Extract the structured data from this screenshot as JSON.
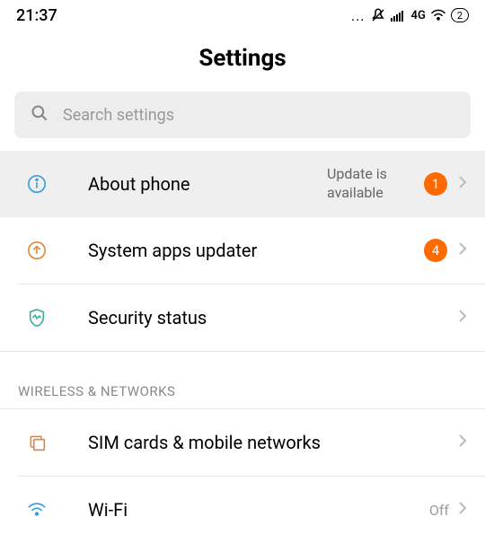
{
  "statusbar": {
    "time": "21:37",
    "network": "4G",
    "battery": "2"
  },
  "page": {
    "title": "Settings"
  },
  "search": {
    "placeholder": "Search settings"
  },
  "items": {
    "about": {
      "label": "About phone",
      "subtext": "Update is available",
      "badge": "1"
    },
    "updater": {
      "label": "System apps updater",
      "badge": "4"
    },
    "security": {
      "label": "Security status"
    }
  },
  "section": {
    "wireless": "WIRELESS & NETWORKS"
  },
  "wireless_items": {
    "sim": {
      "label": "SIM cards & mobile networks"
    },
    "wifi": {
      "label": "Wi-Fi",
      "value": "Off"
    }
  }
}
